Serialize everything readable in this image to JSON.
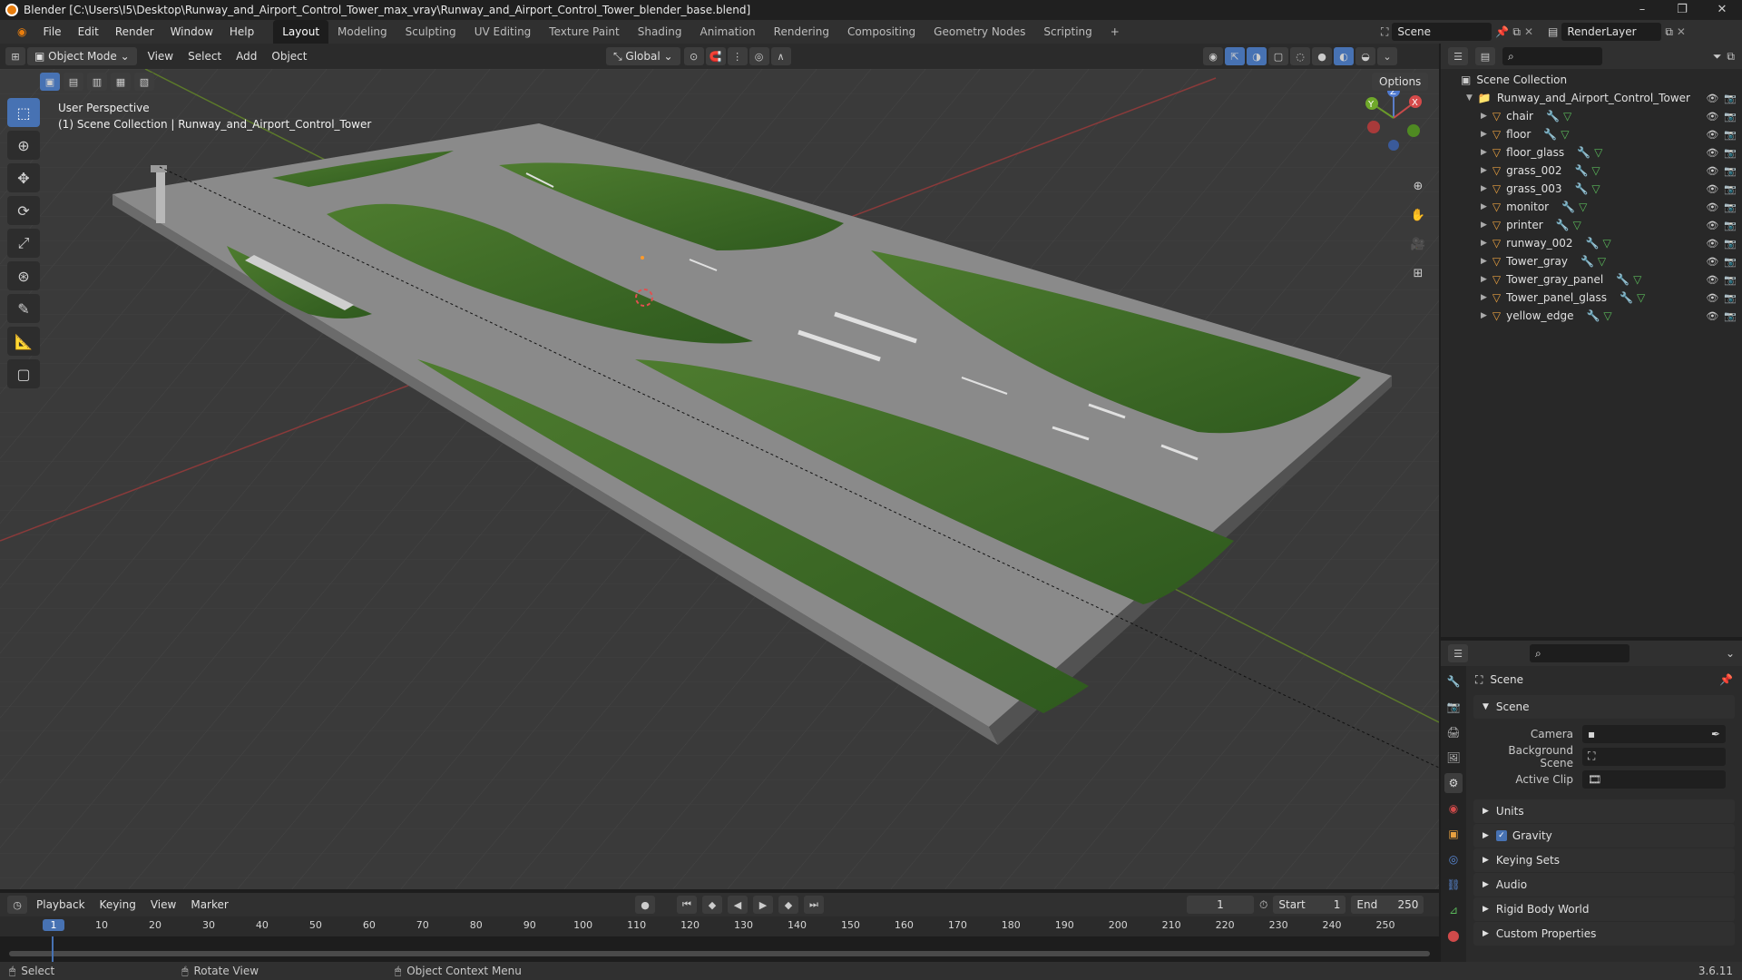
{
  "window": {
    "title": "Blender [C:\\Users\\I5\\Desktop\\Runway_and_Airport_Control_Tower_max_vray\\Runway_and_Airport_Control_Tower_blender_base.blend]"
  },
  "menu": [
    "File",
    "Edit",
    "Render",
    "Window",
    "Help"
  ],
  "workspaces": [
    "Layout",
    "Modeling",
    "Sculpting",
    "UV Editing",
    "Texture Paint",
    "Shading",
    "Animation",
    "Rendering",
    "Compositing",
    "Geometry Nodes",
    "Scripting"
  ],
  "active_workspace": "Layout",
  "scene_field": "Scene",
  "renderlayer_field": "RenderLayer",
  "viewport_header": {
    "mode": "Object Mode",
    "menus": [
      "View",
      "Select",
      "Add",
      "Object"
    ],
    "orientation": "Global",
    "options_label": "Options"
  },
  "viewport": {
    "perspective": "User Perspective",
    "collection": "(1) Scene Collection | Runway_and_Airport_Control_Tower"
  },
  "axis_labels": {
    "x": "X",
    "y": "Y",
    "z": "Z"
  },
  "outliner": {
    "root": "Scene Collection",
    "collection": "Runway_and_Airport_Control_Tower",
    "objects": [
      "chair",
      "floor",
      "floor_glass",
      "grass_002",
      "grass_003",
      "monitor",
      "printer",
      "runway_002",
      "Tower_gray",
      "Tower_gray_panel",
      "Tower_panel_glass",
      "yellow_edge"
    ]
  },
  "properties": {
    "context": "Scene",
    "panel": "Scene",
    "camera_label": "Camera",
    "background_scene_label": "Background Scene",
    "active_clip_label": "Active Clip",
    "sections": [
      "Units",
      "Gravity",
      "Keying Sets",
      "Audio",
      "Rigid Body World",
      "Custom Properties"
    ],
    "gravity_checked": true
  },
  "timeline": {
    "menus": [
      "Playback",
      "Keying",
      "View",
      "Marker"
    ],
    "current_frame": "1",
    "start_label": "Start",
    "start": "1",
    "end_label": "End",
    "end": "250",
    "ticks": [
      "1",
      "10",
      "20",
      "30",
      "40",
      "50",
      "60",
      "70",
      "80",
      "90",
      "100",
      "110",
      "120",
      "130",
      "140",
      "150",
      "160",
      "170",
      "180",
      "190",
      "200",
      "210",
      "220",
      "230",
      "240",
      "250"
    ]
  },
  "status": {
    "select": "Select",
    "rotate": "Rotate View",
    "context_menu": "Object Context Menu",
    "version": "3.6.11"
  }
}
